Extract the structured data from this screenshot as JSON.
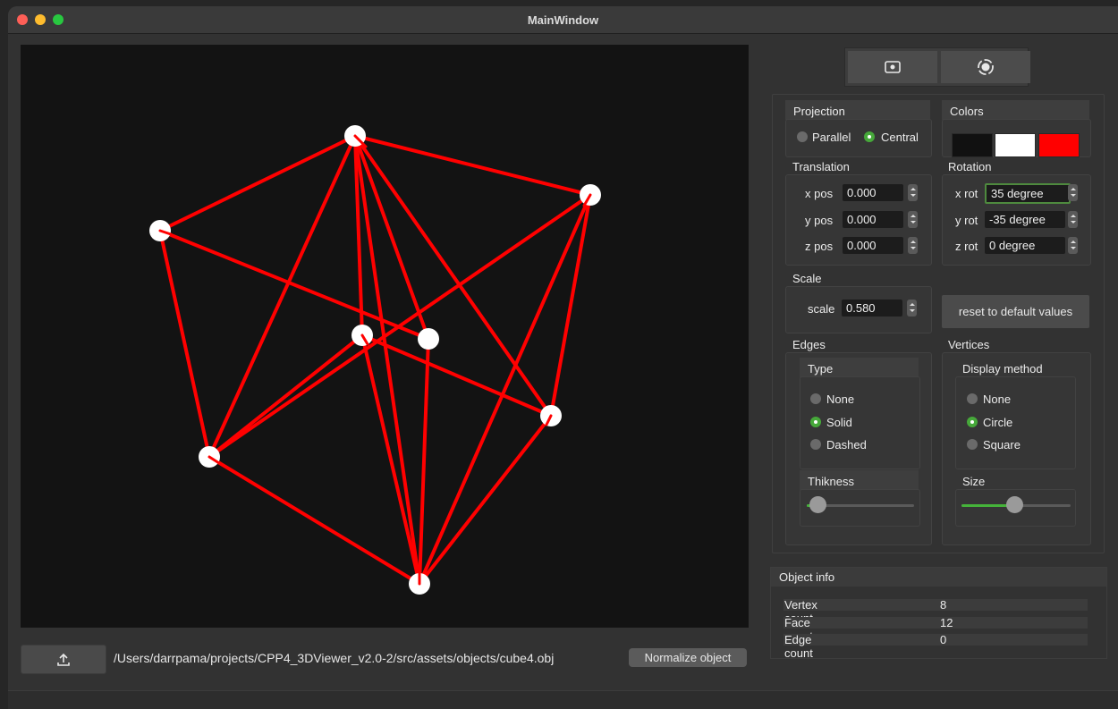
{
  "window": {
    "title": "MainWindow"
  },
  "file": {
    "path": "/Users/darrpama/projects/CPP4_3DViewer_v2.0-2/src/assets/objects/cube4.obj",
    "normalize_label": "Normalize object",
    "upload_icon": "upload-icon"
  },
  "toolbar": {
    "screenshot_icon": "screenshot-icon",
    "record_icon": "record-icon"
  },
  "projection": {
    "title": "Projection",
    "parallel": "Parallel",
    "central": "Central",
    "selected": "Central"
  },
  "colors": {
    "title": "Colors",
    "background": "#111111",
    "vertices": "#ffffff",
    "edges": "#ff0000"
  },
  "translation": {
    "title": "Translation",
    "x_label": "x pos",
    "x_value": "0.000",
    "y_label": "y pos",
    "y_value": "0.000",
    "z_label": "z pos",
    "z_value": "0.000"
  },
  "rotation": {
    "title": "Rotation",
    "x_label": "x rot",
    "x_value": "35 degree",
    "y_label": "y rot",
    "y_value": "-35 degree",
    "z_label": "z rot",
    "z_value": "0 degree"
  },
  "scale": {
    "title": "Scale",
    "label": "scale",
    "value": "0.580"
  },
  "reset": {
    "label": "reset to default values"
  },
  "edges": {
    "title": "Edges",
    "type_title": "Type",
    "none": "None",
    "solid": "Solid",
    "dashed": "Dashed",
    "selected": "Solid",
    "thickness_title": "Thikness",
    "thickness_fraction": 0.1
  },
  "vertices": {
    "title": "Vertices",
    "method_title": "Display method",
    "none": "None",
    "circle": "Circle",
    "square": "Square",
    "selected": "Circle",
    "size_title": "Size",
    "size_fraction": 0.48
  },
  "object_info": {
    "title": "Object info",
    "vertex_label": "Vertex count",
    "vertex_value": "8",
    "face_label": "Face count",
    "face_value": "12",
    "edge_label": "Edge count",
    "edge_value": "0"
  }
}
